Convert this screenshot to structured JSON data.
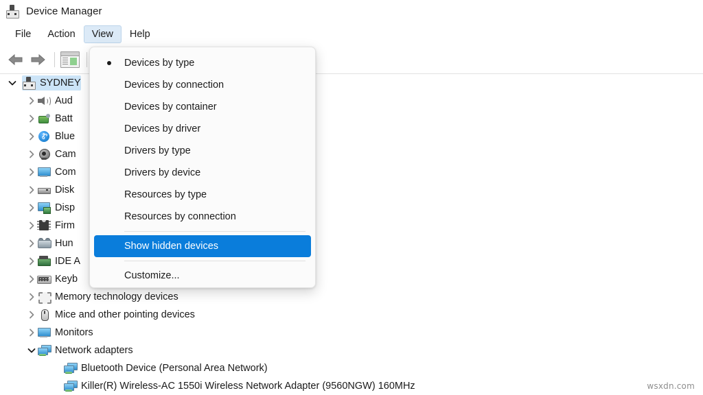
{
  "window": {
    "title": "Device Manager",
    "icon": "device-manager-icon"
  },
  "menubar": {
    "items": [
      {
        "label": "File",
        "active": false
      },
      {
        "label": "Action",
        "active": false
      },
      {
        "label": "View",
        "active": true
      },
      {
        "label": "Help",
        "active": false
      }
    ]
  },
  "toolbar": {
    "buttons": [
      {
        "name": "back-button",
        "icon": "arrow-left-icon",
        "enabled": false
      },
      {
        "name": "forward-button",
        "icon": "arrow-right-icon",
        "enabled": false
      },
      {
        "name": "properties-button",
        "icon": "properties-icon",
        "enabled": true
      }
    ]
  },
  "view_menu": {
    "items": [
      {
        "label": "Devices by type",
        "bullet": true,
        "highlight": false
      },
      {
        "label": "Devices by connection",
        "bullet": false,
        "highlight": false
      },
      {
        "label": "Devices by container",
        "bullet": false,
        "highlight": false
      },
      {
        "label": "Devices by driver",
        "bullet": false,
        "highlight": false
      },
      {
        "label": "Drivers by type",
        "bullet": false,
        "highlight": false
      },
      {
        "label": "Drivers by device",
        "bullet": false,
        "highlight": false
      },
      {
        "label": "Resources by type",
        "bullet": false,
        "highlight": false
      },
      {
        "label": "Resources by connection",
        "bullet": false,
        "highlight": false
      },
      {
        "label": "Show hidden devices",
        "bullet": false,
        "highlight": true
      },
      {
        "label": "Customize...",
        "bullet": false,
        "highlight": false
      }
    ],
    "separator_after": [
      7,
      8
    ]
  },
  "tree": {
    "root": {
      "label": "SYDNEY",
      "icon": "computer-icon",
      "expanded": true,
      "selected": true
    },
    "nodes": [
      {
        "label": "Audio inputs and outputs",
        "visible_label": "Aud",
        "icon": "speaker-icon",
        "expanded": false,
        "depth": 1
      },
      {
        "label": "Batteries",
        "visible_label": "Batt",
        "icon": "battery-icon",
        "expanded": false,
        "depth": 1
      },
      {
        "label": "Bluetooth",
        "visible_label": "Blue",
        "icon": "bluetooth-icon",
        "expanded": false,
        "depth": 1
      },
      {
        "label": "Cameras",
        "visible_label": "Cam",
        "icon": "camera-icon",
        "expanded": false,
        "depth": 1
      },
      {
        "label": "Computer",
        "visible_label": "Com",
        "icon": "monitor-icon",
        "expanded": false,
        "depth": 1
      },
      {
        "label": "Disk drives",
        "visible_label": "Disk",
        "icon": "disk-drive-icon",
        "expanded": false,
        "depth": 1
      },
      {
        "label": "Display adapters",
        "visible_label": "Disp",
        "icon": "display-adapter-icon",
        "expanded": false,
        "depth": 1
      },
      {
        "label": "Firmware",
        "visible_label": "Firm",
        "icon": "chip-icon",
        "expanded": false,
        "depth": 1
      },
      {
        "label": "Human Interface Devices",
        "visible_label": "Hun",
        "icon": "hid-icon",
        "expanded": false,
        "depth": 1
      },
      {
        "label": "IDE ATA/ATAPI controllers",
        "visible_label": "IDE A",
        "icon": "ide-controller-icon",
        "expanded": false,
        "depth": 1
      },
      {
        "label": "Keyboards",
        "visible_label": "Keyb",
        "icon": "keyboard-icon",
        "expanded": false,
        "depth": 1
      },
      {
        "label": "Memory technology devices",
        "visible_label": "Memory technology devices",
        "icon": "memory-icon",
        "expanded": false,
        "depth": 1
      },
      {
        "label": "Mice and other pointing devices",
        "visible_label": "Mice and other pointing devices",
        "icon": "mouse-icon",
        "expanded": false,
        "depth": 1
      },
      {
        "label": "Monitors",
        "visible_label": "Monitors",
        "icon": "monitor-icon",
        "expanded": false,
        "depth": 1
      },
      {
        "label": "Network adapters",
        "visible_label": "Network adapters",
        "icon": "network-adapter-icon",
        "expanded": true,
        "depth": 1
      },
      {
        "label": "Bluetooth Device (Personal Area Network)",
        "visible_label": "Bluetooth Device (Personal Area Network)",
        "icon": "network-adapter-icon",
        "expanded": null,
        "depth": 2
      },
      {
        "label": "Killer(R) Wireless-AC 1550i Wireless Network Adapter (9560NGW) 160MHz",
        "visible_label": "Killer(R) Wireless-AC 1550i Wireless Network Adapter (9560NGW) 160MHz",
        "icon": "network-adapter-icon",
        "expanded": null,
        "depth": 2
      }
    ]
  },
  "watermark": {
    "text": "wsxdn.com"
  },
  "colors": {
    "menu_highlight": "#0a7ddb",
    "tree_selection": "#cce4f7",
    "menubar_active": "#dceaf7",
    "text": "#1b1b1b"
  }
}
